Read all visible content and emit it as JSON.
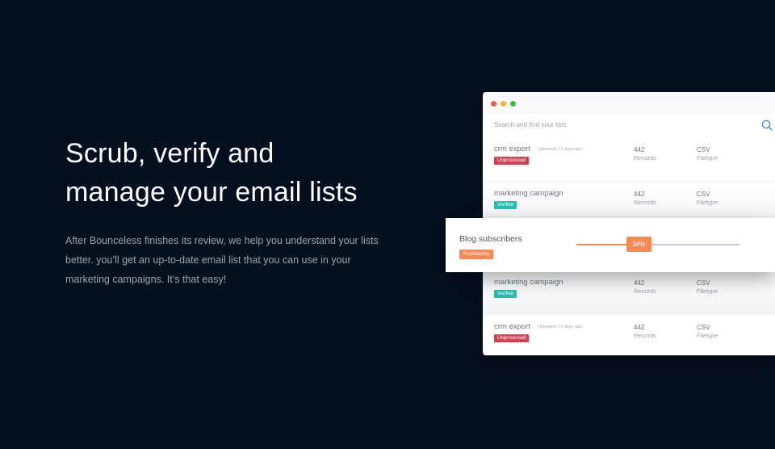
{
  "hero": {
    "headline_line1": "Scrub, verify and",
    "headline_line2": "manage your email lists",
    "sub_line1": "After Bounceless finishes its review, we help you understand your lists",
    "sub_line2": "better. you’ll get an up-to-date email list that you can use in your",
    "sub_line3": "marketing campaigns. It’s that easy!"
  },
  "app": {
    "search_placeholder": "Search and find your lists",
    "rows": [
      {
        "name": "crm export",
        "meta": "Uploaded 13 days ago",
        "status": "Unprocessed",
        "records": "442",
        "records_label": "Records",
        "filetype": "CSV",
        "filetype_label": "Filetype"
      },
      {
        "name": "marketing campaign",
        "meta": "",
        "status": "Verified",
        "records": "442",
        "records_label": "Records",
        "filetype": "CSV",
        "filetype_label": "Filetype"
      },
      {
        "name": "marketing campaign",
        "meta": "",
        "status": "Verified",
        "records": "442",
        "records_label": "Records",
        "filetype": "CSV",
        "filetype_label": "Filetype"
      },
      {
        "name": "crm export",
        "meta": "Uploaded 13 days ago",
        "status": "Unprocessed",
        "records": "442",
        "records_label": "Records",
        "filetype": "CSV",
        "filetype_label": "Filetype"
      }
    ],
    "processing_item": {
      "name": "Blog subscribers",
      "status": "Processing",
      "progress_label": "34%",
      "progress": 0.34
    }
  },
  "colors": {
    "background": "#060f1f",
    "accent_orange": "#f58a55",
    "unprocessed_red": "#cf4255",
    "verified_teal": "#2bbbad"
  },
  "icons": {
    "search": "search-icon"
  }
}
